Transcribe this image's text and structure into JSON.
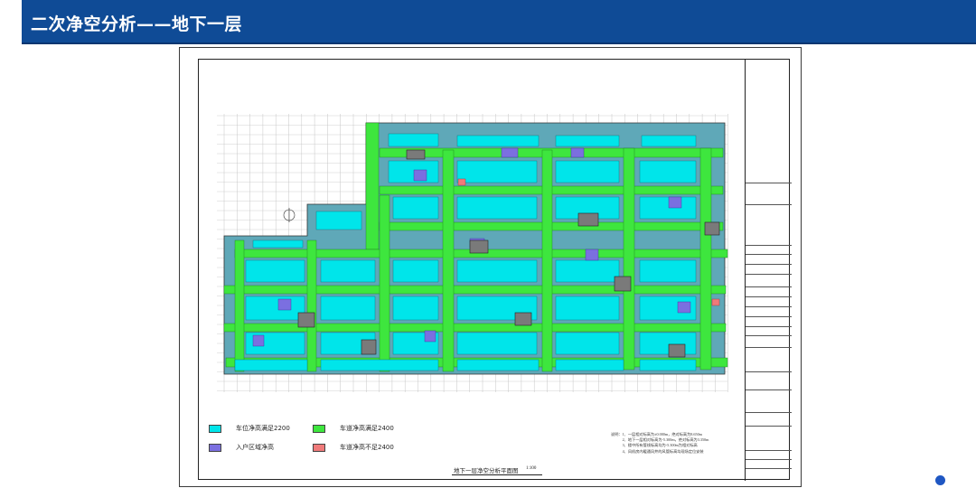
{
  "header": {
    "title": "二次净空分析——地下一层"
  },
  "plan": {
    "title": "地下一层净空分析平面图",
    "scale": "1:100"
  },
  "legend": [
    {
      "label": "车位净高满足2200",
      "color": "#00e5ea"
    },
    {
      "label": "车道净高满足2400",
      "color": "#3ee63e"
    },
    {
      "label": "入户区域净高",
      "color": "#7b6fe0"
    },
    {
      "label": "车道净高不足2400",
      "color": "#f07a7a"
    }
  ],
  "notes": "说明：1、一层相对标高为±0.000m，绝对标高为8.650m\n　　　2、地下一层相对标高为-5.300m，绝对标高为3.350m\n　　　3、楼中所有管线标高均为-5.300m为相对标高\n　　　4、风机房内暖通风井的风管标高均现场定位安装",
  "colors": {
    "header_bg": "#0f4b96",
    "parking": "#00e5ea",
    "lane": "#3ee63e",
    "entry": "#7b6fe0",
    "lane_bad": "#f07a7a"
  }
}
